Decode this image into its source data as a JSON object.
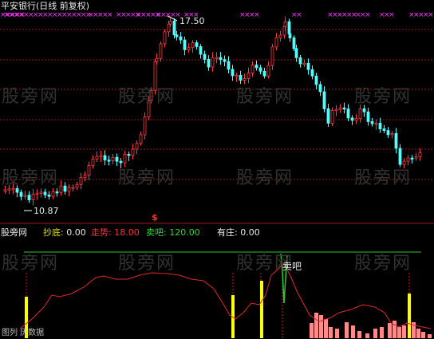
{
  "main_chart": {
    "title": "平安银行(日线 前复权)",
    "high_label": "17.50",
    "low_label": "10.87",
    "dollar_marker": "$"
  },
  "sub_chart": {
    "source_label": "股旁网",
    "indicators": [
      {
        "name": "抄底",
        "value": "0.00",
        "color": "#d6d61a"
      },
      {
        "name": "走势",
        "value": "18.00",
        "color": "#ff3030"
      },
      {
        "name": "卖吧",
        "value": "120.00",
        "color": "#30d830"
      },
      {
        "name": "有庄",
        "value": "0.00",
        "color": "#e8e8e8"
      }
    ],
    "sell_annotation": "卖吧",
    "footer_text": "图列 历数据"
  },
  "watermark_text": "股旁网",
  "colors": {
    "up": "#ff3c3c",
    "down": "#54ffff",
    "grid": "#8b1a1a",
    "marker_x": "#ff33ff",
    "bottom_bars": "#ff8a8a",
    "yellow_bars": "#ffff00"
  }
}
